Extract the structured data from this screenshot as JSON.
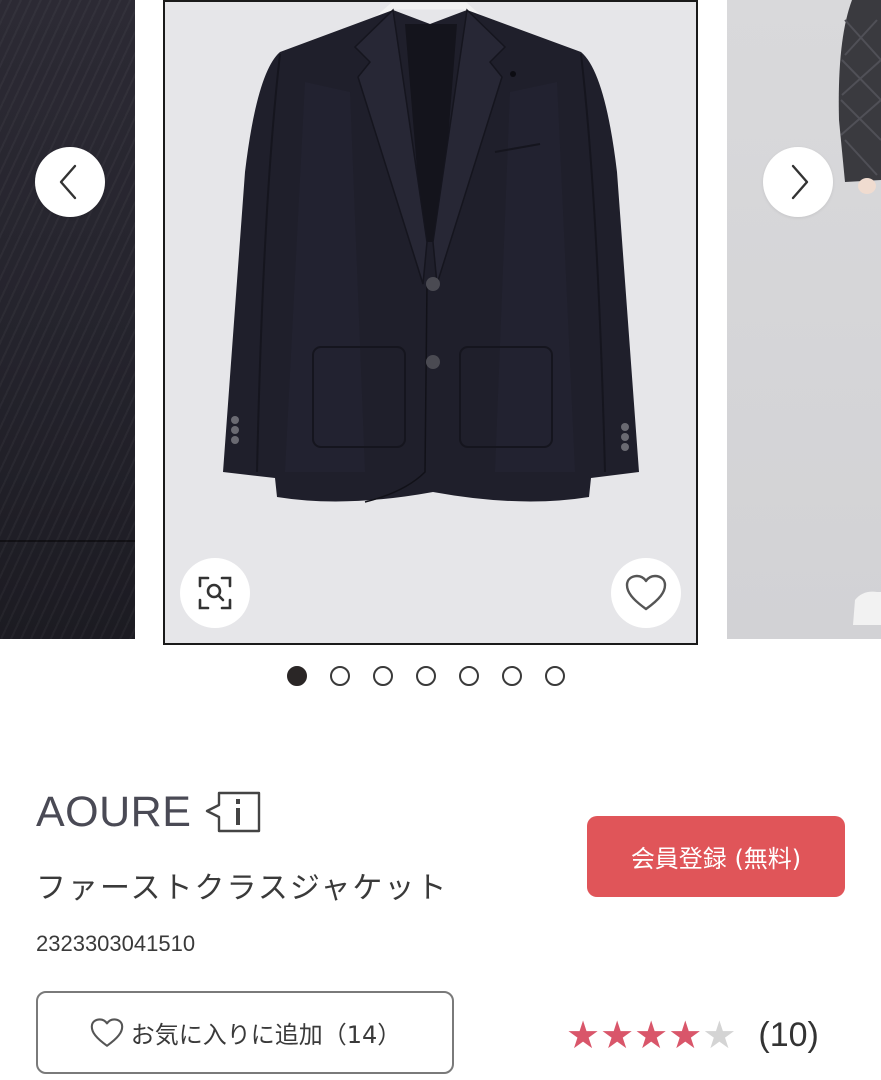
{
  "carousel": {
    "prev_label": "previous",
    "next_label": "next",
    "total_slides": 7,
    "active_slide": 1
  },
  "brand": {
    "name": "AOURE"
  },
  "product": {
    "name": "ファーストクラスジャケット",
    "code": "2323303041510"
  },
  "member_button": {
    "label": "会員登録 (無料)"
  },
  "favorite_button": {
    "label": "お気に入りに追加（14）"
  },
  "rating": {
    "stars": 4,
    "max_stars": 5,
    "count_label": "(10)"
  },
  "colors": {
    "accent_red": "#e05559",
    "star_pink": "#d9566a",
    "star_gray": "#d4d4d4",
    "brand_text": "#4a4a55"
  },
  "icons": {
    "prev": "chevron-left-icon",
    "next": "chevron-right-icon",
    "zoom": "search-zoom-icon",
    "favorite": "heart-icon",
    "brand_info": "info-icon"
  }
}
